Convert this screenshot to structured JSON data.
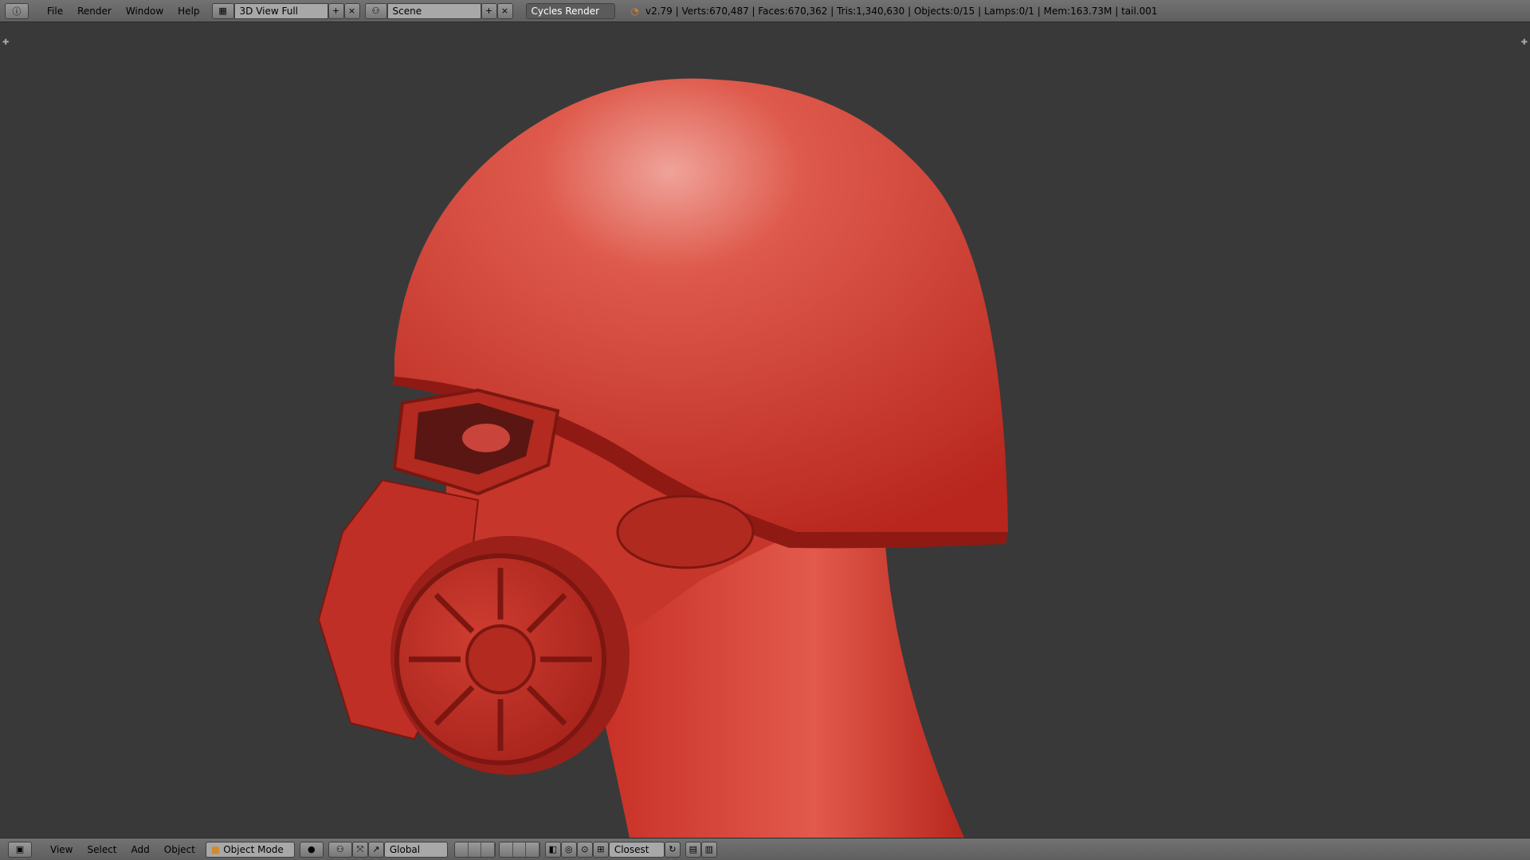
{
  "topbar": {
    "menus": [
      "File",
      "Render",
      "Window",
      "Help"
    ],
    "screen_layout": "3D View Full",
    "scene": "Scene",
    "engine": "Cycles Render",
    "stats": "v2.79 | Verts:670,487 | Faces:670,362 | Tris:1,340,630 | Objects:0/15 | Lamps:0/1 | Mem:163.73M | tail.001"
  },
  "bottombar": {
    "menus": [
      "View",
      "Select",
      "Add",
      "Object"
    ],
    "mode": "Object Mode",
    "orientation": "Global",
    "snap": "Closest"
  },
  "icons": [
    "info-icon",
    "layout-icon",
    "add-icon",
    "close-icon",
    "scene-icon",
    "blender-logo-icon",
    "view3d-icon",
    "object-mode-icon",
    "shading-icon",
    "pivot-icon",
    "manipulator-icon",
    "layers-icon",
    "snap-icon",
    "render-icon"
  ],
  "colors": {
    "model": "#c9322a",
    "background": "#393939",
    "header": "#686868"
  }
}
